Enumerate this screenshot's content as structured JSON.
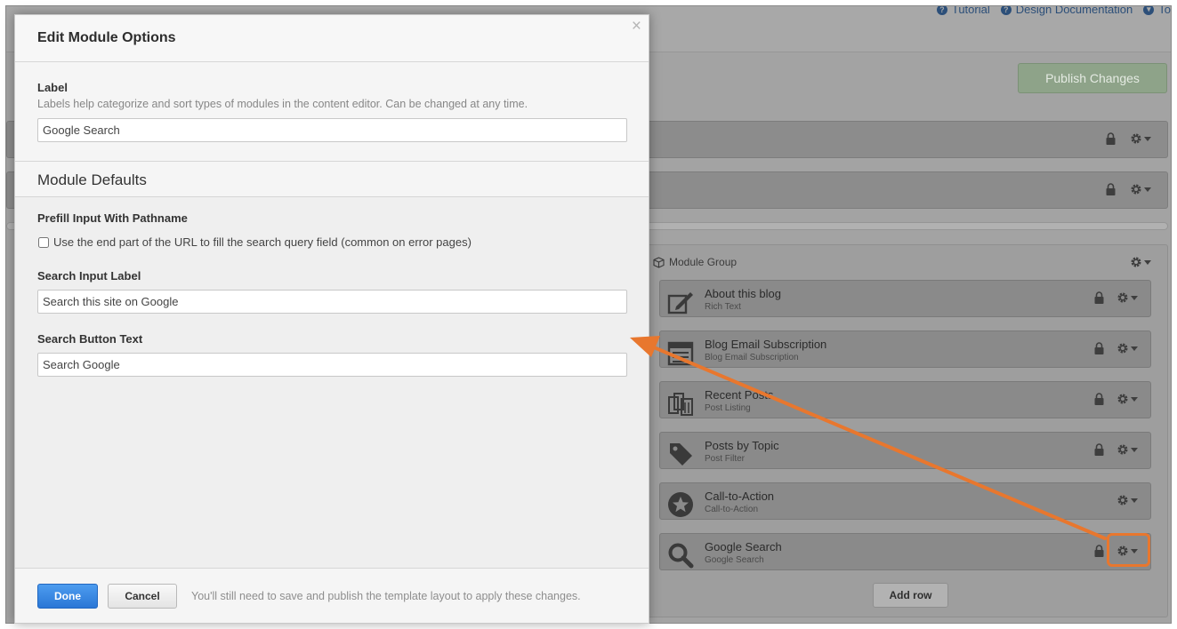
{
  "top_links": [
    {
      "label": "Tutorial"
    },
    {
      "label": "Design Documentation"
    },
    {
      "label": "To"
    }
  ],
  "toolbar": {
    "publish_label": "Publish Changes"
  },
  "module_group": {
    "title": "Module Group",
    "modules": [
      {
        "name": "About this blog",
        "type": "Rich Text",
        "icon": "edit-icon",
        "locked": true
      },
      {
        "name": "Blog Email Subscription",
        "type": "Blog Email Subscription",
        "icon": "email-form-icon",
        "locked": true
      },
      {
        "name": "Recent Posts",
        "type": "Post Listing",
        "icon": "post-listing-icon",
        "locked": true
      },
      {
        "name": "Posts by Topic",
        "type": "Post Filter",
        "icon": "tag-icon",
        "locked": true
      },
      {
        "name": "Call-to-Action",
        "type": "Call-to-Action",
        "icon": "star-icon",
        "locked": false
      },
      {
        "name": "Google Search",
        "type": "Google Search",
        "icon": "search-icon",
        "locked": true
      }
    ],
    "add_row_label": "Add row"
  },
  "modal": {
    "title": "Edit Module Options",
    "close_glyph": "×",
    "label_heading": "Label",
    "label_help": "Labels help categorize and sort types of modules in the content editor. Can be changed at any time.",
    "label_value": "Google Search",
    "defaults_heading": "Module Defaults",
    "prefill_heading": "Prefill Input With Pathname",
    "prefill_checkbox_label": "Use the end part of the URL to fill the search query field (common on error pages)",
    "prefill_checked": false,
    "search_input_label_heading": "Search Input Label",
    "search_input_label_value": "Search this site on Google",
    "search_button_text_heading": "Search Button Text",
    "search_button_text_value": "Search Google",
    "done_label": "Done",
    "cancel_label": "Cancel",
    "footer_note": "You'll still need to save and publish the template layout to apply these changes."
  },
  "colors": {
    "accent_blue": "#2a77d6",
    "annotation_orange": "#e8772e",
    "publish_green": "#8ea389"
  }
}
